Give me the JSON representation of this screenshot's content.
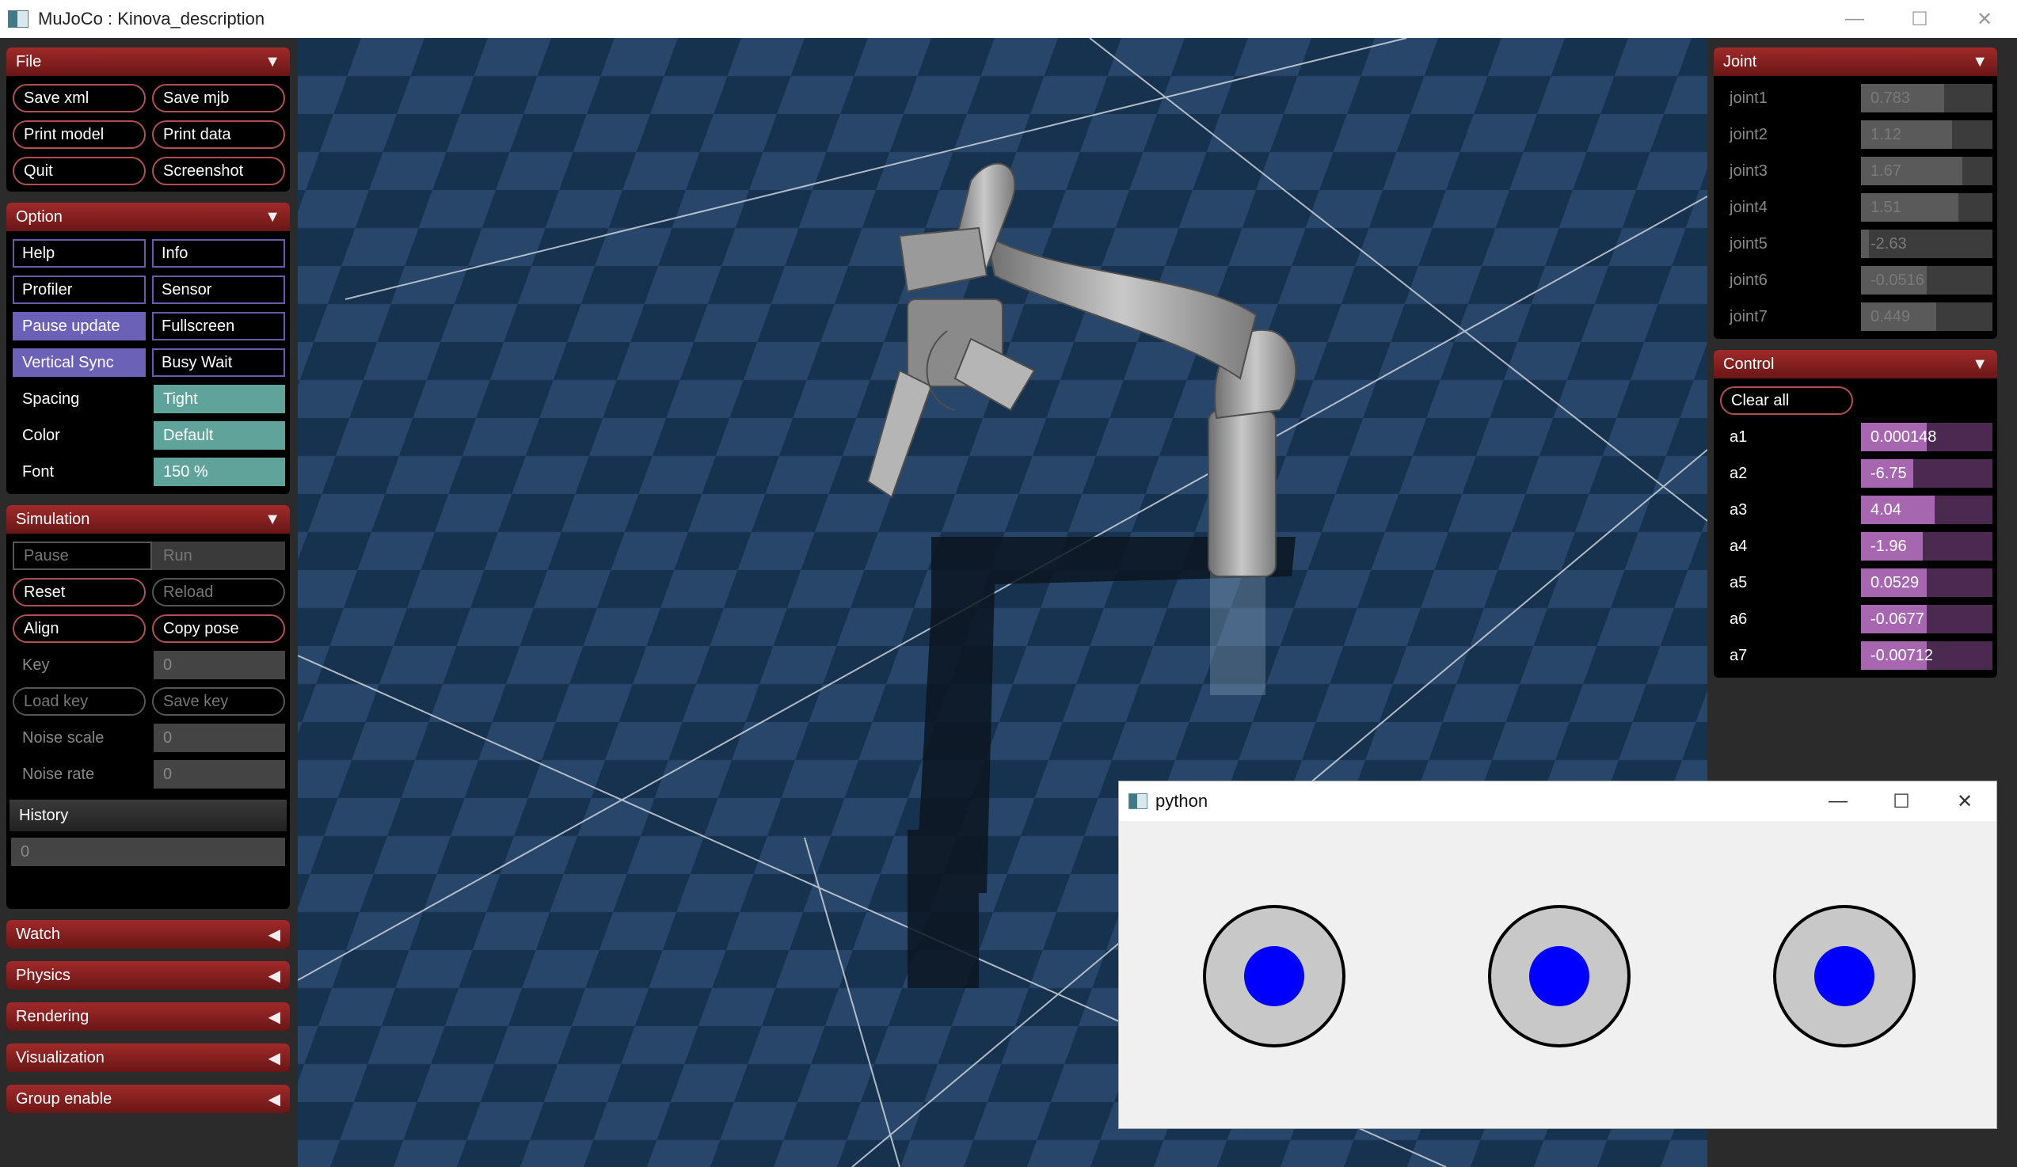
{
  "window": {
    "title": "MuJoCo : Kinova_description",
    "minimize": "—",
    "maximize": "☐",
    "close": "✕"
  },
  "file": {
    "title": "File",
    "buttons": [
      "Save xml",
      "Save mjb",
      "Print model",
      "Print data",
      "Quit",
      "Screenshot"
    ]
  },
  "option": {
    "title": "Option",
    "toggles": [
      "Help",
      "Info",
      "Profiler",
      "Sensor",
      "Pause update",
      "Fullscreen",
      "Vertical Sync",
      "Busy Wait"
    ],
    "spacing_label": "Spacing",
    "spacing_value": "Tight",
    "color_label": "Color",
    "color_value": "Default",
    "font_label": "Font",
    "font_value": "150 %"
  },
  "simulation": {
    "title": "Simulation",
    "pause": "Pause",
    "run": "Run",
    "reset": "Reset",
    "reload": "Reload",
    "align": "Align",
    "copy_pose": "Copy pose",
    "key_label": "Key",
    "key_value": "0",
    "load_key": "Load key",
    "save_key": "Save key",
    "noise_scale_label": "Noise scale",
    "noise_scale_value": "0",
    "noise_rate_label": "Noise rate",
    "noise_rate_value": "0",
    "history_label": "History",
    "history_value": "0"
  },
  "collapsed_sections": [
    "Watch",
    "Physics",
    "Rendering",
    "Visualization",
    "Group enable"
  ],
  "joint": {
    "title": "Joint",
    "items": [
      {
        "name": "joint1",
        "value": "0.783",
        "fill": 0.63
      },
      {
        "name": "joint2",
        "value": "1.12",
        "fill": 0.69
      },
      {
        "name": "joint3",
        "value": "1.67",
        "fill": 0.77
      },
      {
        "name": "joint4",
        "value": "1.51",
        "fill": 0.74
      },
      {
        "name": "joint5",
        "value": "-2.63",
        "fill": 0.06
      },
      {
        "name": "joint6",
        "value": "-0.0516",
        "fill": 0.5
      },
      {
        "name": "joint7",
        "value": "0.449",
        "fill": 0.57
      }
    ]
  },
  "control": {
    "title": "Control",
    "clear_all": "Clear all",
    "items": [
      {
        "name": "a1",
        "value": "0.000148",
        "fill": 0.5
      },
      {
        "name": "a2",
        "value": "-6.75",
        "fill": 0.4
      },
      {
        "name": "a3",
        "value": "4.04",
        "fill": 0.56
      },
      {
        "name": "a4",
        "value": "-1.96",
        "fill": 0.47
      },
      {
        "name": "a5",
        "value": "0.0529",
        "fill": 0.5
      },
      {
        "name": "a6",
        "value": "-0.0677",
        "fill": 0.5
      },
      {
        "name": "a7",
        "value": "-0.00712",
        "fill": 0.5
      }
    ]
  },
  "python_window": {
    "title": "python",
    "minimize": "—",
    "maximize": "☐",
    "close": "✕"
  },
  "colors": {
    "accent": "#a02a2a",
    "toggle_on": "#6b62b8",
    "select": "#5fa39b",
    "control_fill": "#a767b0",
    "knob": "#0000ff"
  }
}
